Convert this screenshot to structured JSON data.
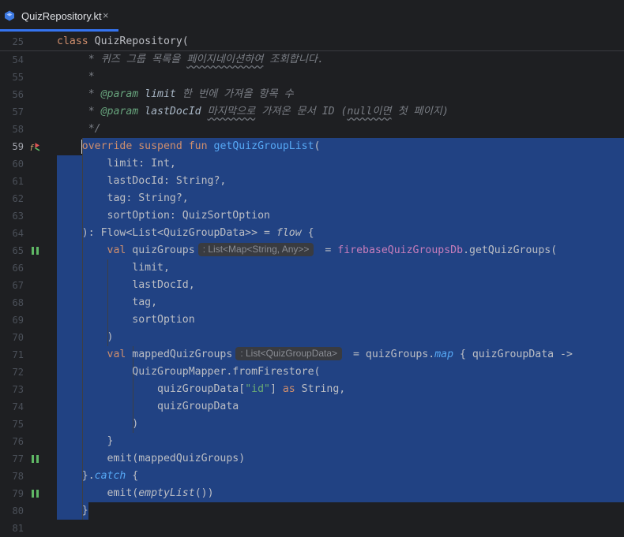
{
  "tab": {
    "label": "QuizRepository.kt",
    "close": "×",
    "icon": "kotlin-file-icon"
  },
  "sticky": {
    "line_number": "25",
    "keyword": "class",
    "name": "QuizRepository("
  },
  "lines": [
    {
      "n": "54",
      "parts": [
        [
          "cm",
          "     * 퀴즈 그룹 목록을 "
        ],
        [
          "cmw",
          "페이지네이션하여"
        ],
        [
          "cm",
          " 조회합니다."
        ]
      ]
    },
    {
      "n": "55",
      "parts": [
        [
          "cm",
          "     *"
        ]
      ]
    },
    {
      "n": "56",
      "parts": [
        [
          "cm",
          "     * "
        ],
        [
          "tagc",
          "@param "
        ],
        [
          "tagv",
          "limit"
        ],
        [
          "cm",
          " 한 번에 가져올 항목 수"
        ]
      ]
    },
    {
      "n": "57",
      "parts": [
        [
          "cm",
          "     * "
        ],
        [
          "tagc",
          "@param "
        ],
        [
          "tagv",
          "lastDocId"
        ],
        [
          "cm",
          " "
        ],
        [
          "cmw",
          "마지막으로"
        ],
        [
          "cm",
          " 가져온 문서 ID ("
        ],
        [
          "cmw",
          "null이면"
        ],
        [
          "cm",
          " 첫 페이지)"
        ]
      ]
    },
    {
      "n": "58",
      "parts": [
        [
          "cm",
          "     */"
        ]
      ]
    },
    {
      "n": "59",
      "parts": [
        [
          "kw",
          "    override suspend fun "
        ],
        [
          "fn",
          "getQuizGroupList"
        ],
        [
          "",
          "("
        ]
      ]
    },
    {
      "n": "60",
      "parts": [
        [
          "",
          "        limit: Int,"
        ]
      ]
    },
    {
      "n": "61",
      "parts": [
        [
          "",
          "        lastDocId: String?,"
        ]
      ]
    },
    {
      "n": "62",
      "parts": [
        [
          "",
          "        tag: String?,"
        ]
      ]
    },
    {
      "n": "63",
      "parts": [
        [
          "",
          "        sortOption: QuizSortOption"
        ]
      ]
    },
    {
      "n": "64",
      "parts": [
        [
          "",
          "    ): Flow<List<QuizGroupData>> = "
        ],
        [
          "it",
          "flow"
        ],
        [
          "",
          " {"
        ]
      ]
    },
    {
      "n": "65",
      "parts": [
        [
          "kw",
          "        val "
        ],
        [
          "",
          "quizGroups"
        ],
        [
          "hint",
          ": List<Map<String, Any>>"
        ],
        [
          "",
          " = "
        ],
        [
          "prop",
          "firebaseQuizGroupsDb"
        ],
        [
          "",
          ".getQuizGroups("
        ]
      ]
    },
    {
      "n": "66",
      "parts": [
        [
          "",
          "            limit,"
        ]
      ]
    },
    {
      "n": "67",
      "parts": [
        [
          "",
          "            lastDocId,"
        ]
      ]
    },
    {
      "n": "68",
      "parts": [
        [
          "",
          "            tag,"
        ]
      ]
    },
    {
      "n": "69",
      "parts": [
        [
          "",
          "            sortOption"
        ]
      ]
    },
    {
      "n": "70",
      "parts": [
        [
          "",
          "        )"
        ]
      ]
    },
    {
      "n": "71",
      "parts": [
        [
          "kw",
          "        val "
        ],
        [
          "",
          "mappedQuizGroups"
        ],
        [
          "hint",
          ": List<QuizGroupData>"
        ],
        [
          "",
          " = quizGroups."
        ],
        [
          "fnit",
          "map"
        ],
        [
          "",
          " { quizGroupData ->"
        ]
      ]
    },
    {
      "n": "72",
      "parts": [
        [
          "",
          "            QuizGroupMapper.fromFirestore("
        ]
      ]
    },
    {
      "n": "73",
      "parts": [
        [
          "",
          "                quizGroupData["
        ],
        [
          "str",
          "\"id\""
        ],
        [
          "",
          "] "
        ],
        [
          "kw",
          "as"
        ],
        [
          "",
          " String,"
        ]
      ]
    },
    {
      "n": "74",
      "parts": [
        [
          "",
          "                quizGroupData"
        ]
      ]
    },
    {
      "n": "75",
      "parts": [
        [
          "",
          "            )"
        ]
      ]
    },
    {
      "n": "76",
      "parts": [
        [
          "",
          "        }"
        ]
      ]
    },
    {
      "n": "77",
      "parts": [
        [
          "",
          "        emit(mappedQuizGroups)"
        ]
      ]
    },
    {
      "n": "78",
      "parts": [
        [
          "",
          "    }."
        ],
        [
          "fnit",
          "catch"
        ],
        [
          "",
          " {"
        ]
      ]
    },
    {
      "n": "79",
      "parts": [
        [
          "",
          "        emit("
        ],
        [
          "it",
          "emptyList"
        ],
        [
          "",
          "())"
        ]
      ]
    },
    {
      "n": "80",
      "parts": [
        [
          "",
          "    }"
        ]
      ]
    },
    {
      "n": "81",
      "parts": [
        [
          "",
          ""
        ]
      ]
    }
  ],
  "colors": {
    "selection": "#214283",
    "keyword": "#cf8e6d",
    "function": "#56a8f5",
    "comment": "#7a7e85",
    "property": "#c77dbb",
    "string": "#6aab73"
  },
  "gutter_markers": {
    "59": "override-run-icon",
    "65": "suspend-call-icon",
    "77": "suspend-call-icon",
    "79": "suspend-call-icon"
  }
}
